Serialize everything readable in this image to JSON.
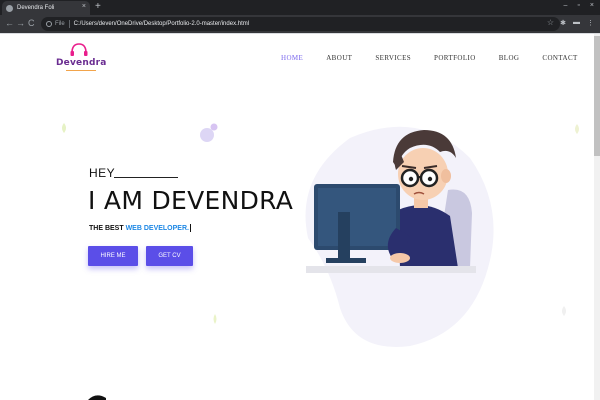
{
  "browser": {
    "tab_title": "Devendra Foli",
    "tab_close": "×",
    "new_tab": "+",
    "back": "←",
    "forward": "→",
    "reload": "C",
    "file_label": "File",
    "url": "C:/Users/deven/OneDrive/Desktop/Portfolio-2.0-master/index.html",
    "star": "☆",
    "win_min": "–",
    "win_max": "▫",
    "win_close": "×",
    "ext_icon": "✱",
    "folder_icon": "▬",
    "menu_icon": "⋮"
  },
  "logo": {
    "text": "Devendra"
  },
  "nav": {
    "items": [
      {
        "label": "HOME",
        "active": true
      },
      {
        "label": "ABOUT",
        "active": false
      },
      {
        "label": "SERVICES",
        "active": false
      },
      {
        "label": "PORTFOLIO",
        "active": false
      },
      {
        "label": "BLOG",
        "active": false
      },
      {
        "label": "CONTACT",
        "active": false
      }
    ]
  },
  "hero": {
    "hey": "HEY",
    "name": "I AM DEVENDRA",
    "subtitle_prefix": "THE BEST ",
    "subtitle_highlight": "WEB DEVELOPER.",
    "hire_label": "HIRE ME",
    "cv_label": "GET CV"
  },
  "colors": {
    "accent": "#5b4ee8",
    "nav_active": "#7b68ee",
    "highlight": "#1e88e5",
    "logo": "#6a2c91"
  }
}
